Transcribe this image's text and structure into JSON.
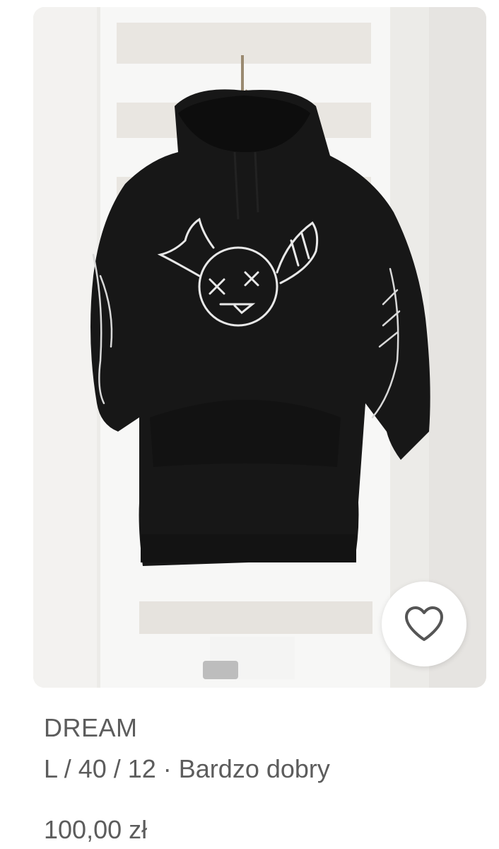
{
  "listing": {
    "brand": "DREAM",
    "details": "L / 40 / 12 · Bardzo dobry",
    "price": "100,00 zł",
    "favorite_icon": "heart-outline-icon",
    "colors": {
      "text": "#5c5c5c",
      "hoodie": "#161616",
      "background": "#eeece9"
    }
  }
}
